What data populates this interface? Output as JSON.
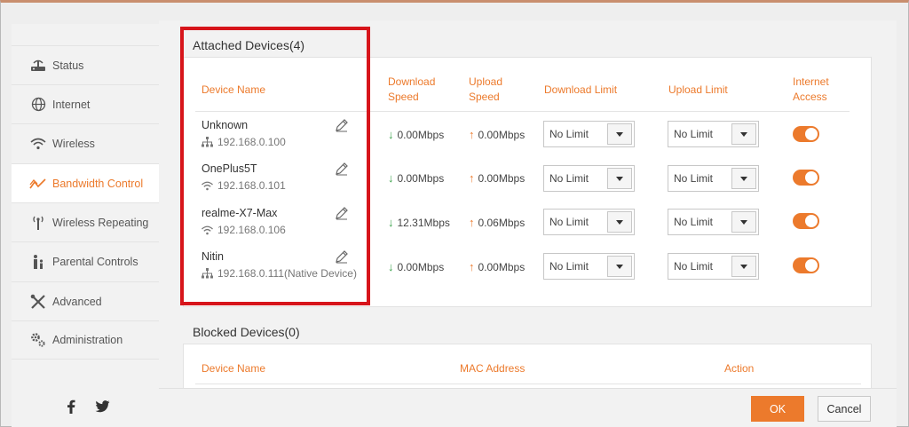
{
  "sidebar": {
    "items": [
      {
        "label": "Status",
        "icon": "router-icon"
      },
      {
        "label": "Internet",
        "icon": "globe-icon"
      },
      {
        "label": "Wireless",
        "icon": "wifi-icon"
      },
      {
        "label": "Bandwidth Control",
        "icon": "bandwidth-icon"
      },
      {
        "label": "Wireless Repeating",
        "icon": "repeater-icon"
      },
      {
        "label": "Parental Controls",
        "icon": "parental-icon"
      },
      {
        "label": "Advanced",
        "icon": "tools-icon"
      },
      {
        "label": "Administration",
        "icon": "gears-icon"
      }
    ],
    "active": "Bandwidth Control",
    "social": [
      "facebook-icon",
      "twitter-icon"
    ]
  },
  "attached": {
    "title": "Attached Devices(4)",
    "columns": {
      "device_name": "Device Name",
      "download_speed": "Download\nSpeed",
      "upload_speed": "Upload\nSpeed",
      "download_limit": "Download Limit",
      "upload_limit": "Upload Limit",
      "internet_access": "Internet\nAccess"
    },
    "devices": [
      {
        "name": "Unknown",
        "ip": "192.168.0.100",
        "conn": "lan",
        "down": "0.00Mbps",
        "up": "0.00Mbps",
        "dl_limit": "No Limit",
        "ul_limit": "No Limit",
        "access": true
      },
      {
        "name": "OnePlus5T",
        "ip": "192.168.0.101",
        "conn": "wifi",
        "down": "0.00Mbps",
        "up": "0.00Mbps",
        "dl_limit": "No Limit",
        "ul_limit": "No Limit",
        "access": true
      },
      {
        "name": "realme-X7-Max",
        "ip": "192.168.0.106",
        "conn": "wifi",
        "down": "12.31Mbps",
        "up": "0.06Mbps",
        "dl_limit": "No Limit",
        "ul_limit": "No Limit",
        "access": true
      },
      {
        "name": "Nitin",
        "ip": "192.168.0.111(Native Device)",
        "conn": "lan",
        "down": "0.00Mbps",
        "up": "0.00Mbps",
        "dl_limit": "No Limit",
        "ul_limit": "No Limit",
        "access": true
      }
    ]
  },
  "blocked": {
    "title": "Blocked Devices(0)",
    "columns": {
      "device_name": "Device Name",
      "mac": "MAC Address",
      "action": "Action"
    }
  },
  "footer": {
    "ok_label": "OK",
    "cancel_label": "Cancel"
  },
  "colors": {
    "accent": "#ec7a2c",
    "highlight": "#d7151b",
    "down_arrow": "#3aa14a"
  }
}
